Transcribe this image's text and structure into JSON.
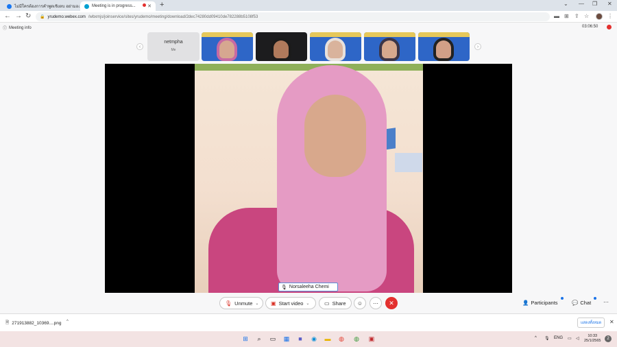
{
  "browser": {
    "tabs": [
      {
        "title": "ไม่มีใครต้องการคำพูดเชิงลบ อย่ามองข้าม"
      },
      {
        "title": "Meeting is in progress..."
      }
    ],
    "new_tab": "+",
    "window_controls": [
      "⌄",
      "—",
      "❐",
      "✕"
    ],
    "url_host": "yrudemo.webex.com",
    "url_path": "/wbxmjs/joinservice/sites/yrudemo/meeting/download/2dec74280dd09410de782288b5108f53"
  },
  "meeting": {
    "info_label": "Meeting info",
    "timer": "03:06:50",
    "me_name": "netmpha",
    "me_tag": "Me",
    "active_speaker": "Norsaleeha Chemi",
    "thumbnails": [
      {
        "face_color": "#d6a790",
        "hijab_color": "#c76aa3"
      },
      {
        "face_color": "#b07a5c",
        "hijab_color": "#1b1b1b"
      },
      {
        "face_color": "#d9b39c",
        "hijab_color": "#e8e1dc"
      },
      {
        "face_color": "#d7a98d",
        "hijab_color": "#3b3547"
      },
      {
        "face_color": "#d2a087",
        "hijab_color": "#222222"
      }
    ]
  },
  "controls": {
    "unmute": "Unmute",
    "start_video": "Start video",
    "share": "Share",
    "participants": "Participants",
    "chat": "Chat"
  },
  "downloads": {
    "file_name": "271913882_10369....png",
    "show_all": "แสดงทั้งหมด"
  },
  "taskbar": {
    "lang": "ENG",
    "time": "10:33",
    "date": "25/1/2565",
    "notifications": "2"
  },
  "colors": {
    "end_call": "#e3302e",
    "accent": "#1a73e8",
    "tile_bg": "#2e66c7"
  }
}
